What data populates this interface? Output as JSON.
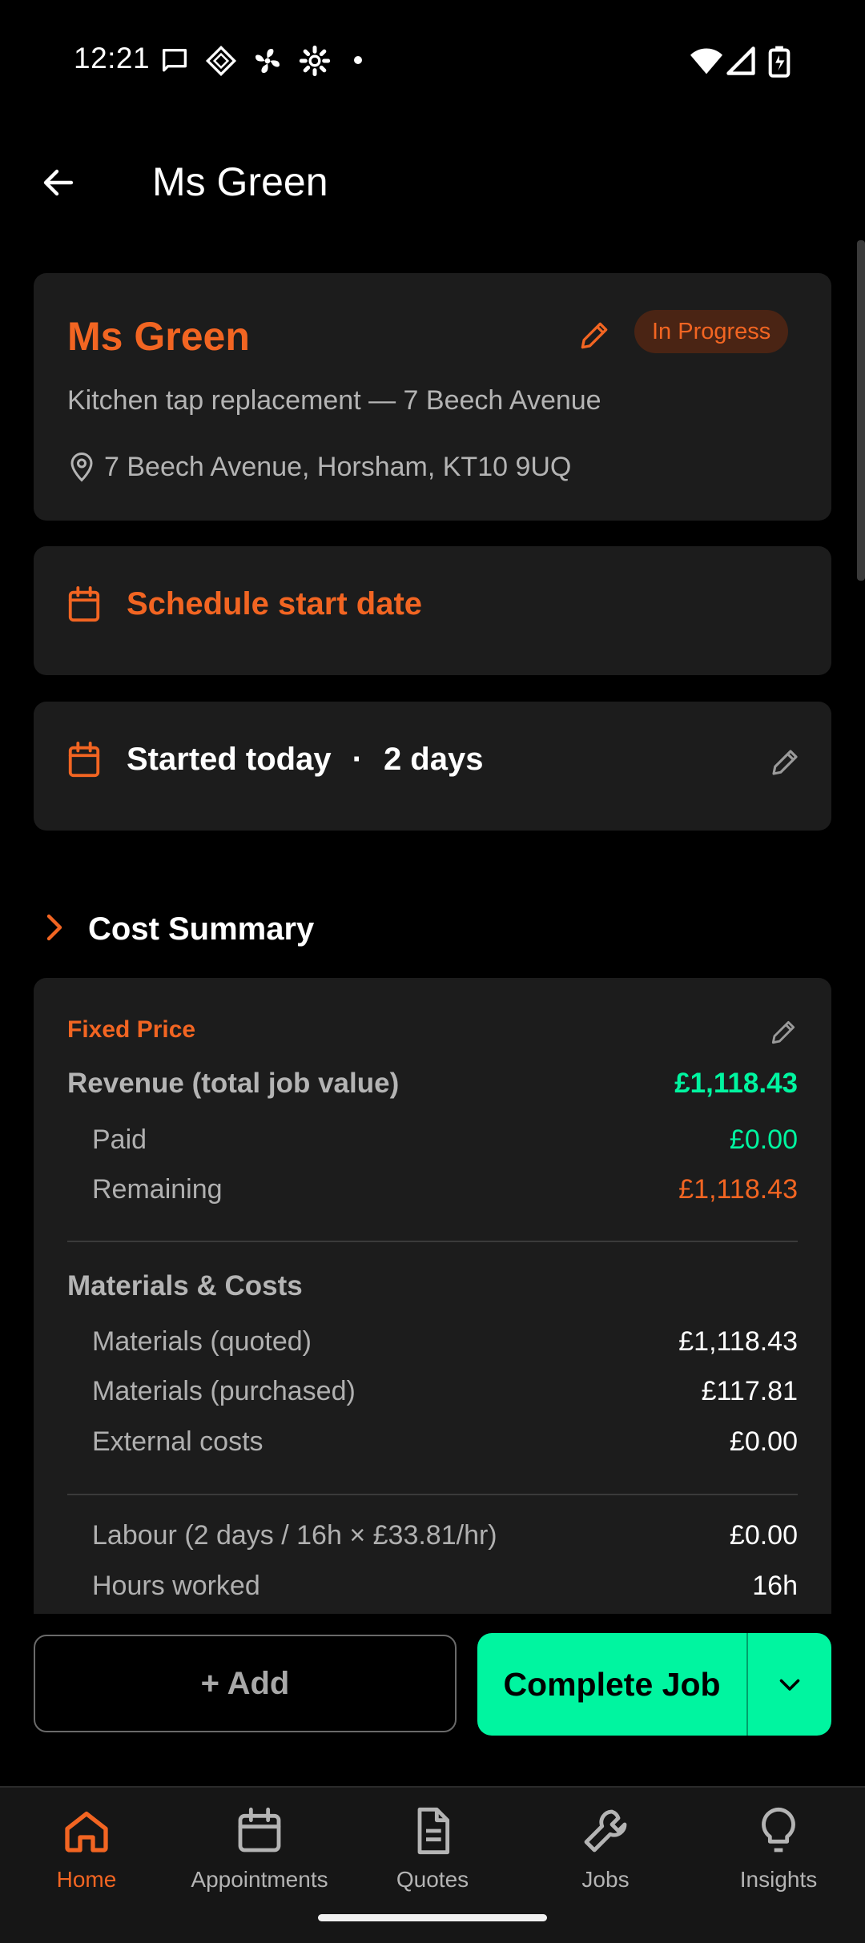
{
  "status_bar": {
    "time": "12:21",
    "left_icons": [
      "message-icon",
      "app-icon",
      "fan-icon",
      "settings-icon",
      "dot-icon"
    ],
    "right_icons": [
      "wifi-icon",
      "cell-signal-icon",
      "battery-icon"
    ]
  },
  "header": {
    "back_icon": "arrow-left-icon",
    "title": "Ms Green"
  },
  "job_card": {
    "client_name": "Ms Green",
    "status": "In Progress",
    "description": "Kitchen tap replacement — 7 Beech Avenue",
    "address": "7 Beech Avenue, Horsham, KT10 9UQ"
  },
  "schedule_card": {
    "label": "Schedule start date"
  },
  "started_card": {
    "started": "Started today",
    "separator": "·",
    "duration": "2 days"
  },
  "cost_summary": {
    "title": "Cost Summary",
    "pricing_type": "Fixed Price",
    "revenue_label": "Revenue (total job value)",
    "revenue_value": "£1,118.43",
    "paid_label": "Paid",
    "paid_value": "£0.00",
    "remaining_label": "Remaining",
    "remaining_value": "£1,118.43",
    "materials_heading": "Materials & Costs",
    "materials_quoted_label": "Materials (quoted)",
    "materials_quoted_value": "£1,118.43",
    "materials_purchased_label": "Materials (purchased)",
    "materials_purchased_value": "£117.81",
    "external_costs_label": "External costs",
    "external_costs_value": "£0.00",
    "labour_label": "Labour (2 days / 16h × £33.81/hr)",
    "labour_value": "£0.00",
    "hours_label": "Hours worked",
    "hours_value": "16h"
  },
  "actions": {
    "add_label": "+ Add",
    "complete_label": "Complete Job"
  },
  "nav": {
    "items": [
      {
        "label": "Home",
        "icon": "home-icon",
        "active": true
      },
      {
        "label": "Appointments",
        "icon": "calendar-icon",
        "active": false
      },
      {
        "label": "Quotes",
        "icon": "document-icon",
        "active": false
      },
      {
        "label": "Jobs",
        "icon": "wrench-icon",
        "active": false
      },
      {
        "label": "Insights",
        "icon": "lightbulb-icon",
        "active": false
      }
    ]
  },
  "colors": {
    "accent": "#f26522",
    "success": "#00f5a0",
    "background": "#000000",
    "card": "#1c1c1c"
  }
}
